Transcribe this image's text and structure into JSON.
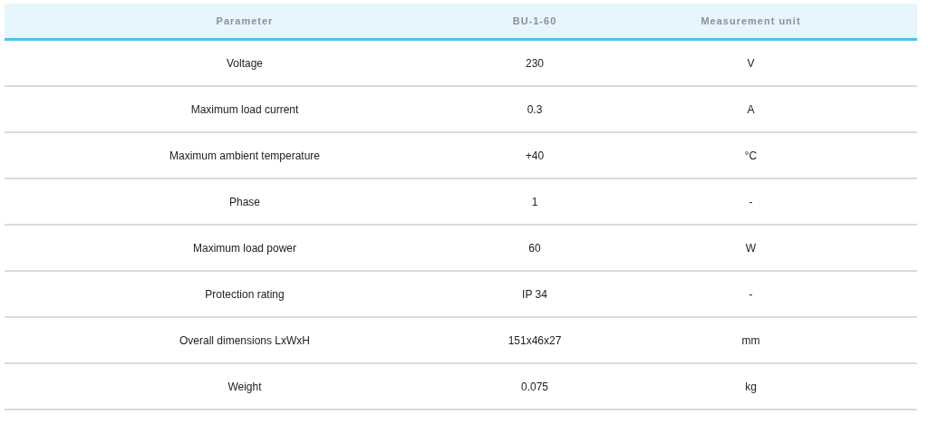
{
  "table": {
    "columns": [
      "Parameter",
      "BU-1-60",
      "Measurement unit"
    ],
    "rows": [
      [
        "Voltage",
        "230",
        "V"
      ],
      [
        "Maximum load current",
        "0.3",
        "A"
      ],
      [
        "Maximum ambient temperature",
        "+40",
        "°C"
      ],
      [
        "Phase",
        "1",
        "-"
      ],
      [
        "Maximum load power",
        "60",
        "W"
      ],
      [
        "Protection rating",
        "IP 34",
        "-"
      ],
      [
        "Overall dimensions LxWxH",
        "151x46x27",
        "mm"
      ],
      [
        "Weight",
        "0.075",
        "kg"
      ]
    ]
  }
}
